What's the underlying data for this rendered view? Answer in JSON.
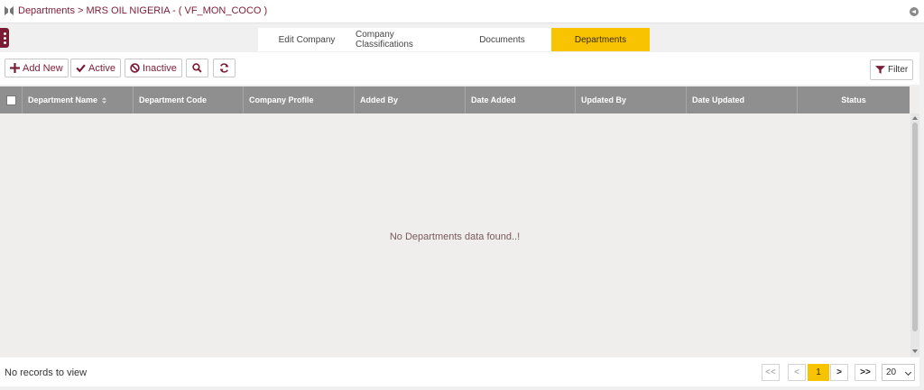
{
  "breadcrumb": "Departments > MRS OIL NIGERIA - ( VF_MON_COCO )",
  "tabs": [
    {
      "label": "Edit Company",
      "active": false
    },
    {
      "label": "Company Classifications",
      "active": false
    },
    {
      "label": "Documents",
      "active": false
    },
    {
      "label": "Departments",
      "active": true
    }
  ],
  "toolbar": {
    "add_new": "Add New",
    "active": "Active",
    "inactive": "Inactive",
    "filter": "Filter"
  },
  "grid": {
    "columns": [
      "Department Name",
      "Department Code",
      "Company Profile",
      "Added By",
      "Date Added",
      "Updated By",
      "Date Updated",
      "Status"
    ],
    "empty_message": "No Departments data found..!"
  },
  "footer": {
    "records_text": "No records to view",
    "first": "<<",
    "prev": "<",
    "current_page": "1",
    "next": ">",
    "last": ">>",
    "page_size": "20"
  },
  "colors": {
    "accent": "#7b1c35",
    "active_tab": "#f8c300",
    "header_bg": "#8f8f8f"
  }
}
